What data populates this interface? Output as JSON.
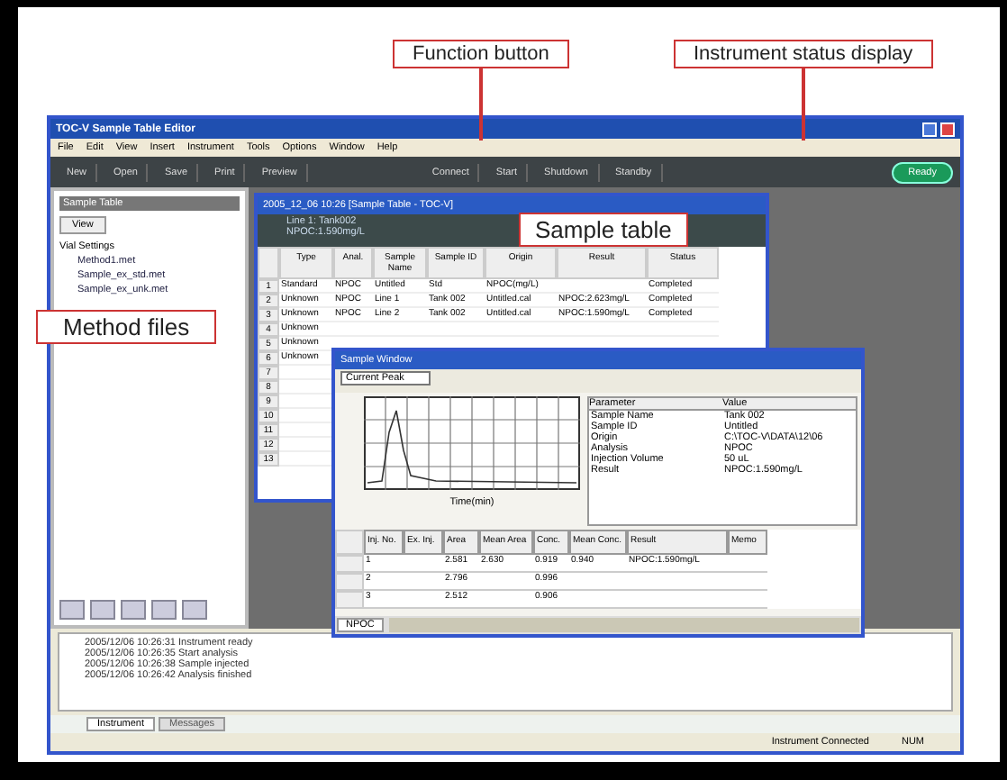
{
  "annotations": [
    {
      "text": "Function button"
    },
    {
      "text": "Instrument status display"
    },
    {
      "text": "Sample table"
    },
    {
      "text": "Method files"
    }
  ],
  "window": {
    "title": "TOC-V Sample Table Editor"
  },
  "menu": [
    "File",
    "Edit",
    "View",
    "Insert",
    "Instrument",
    "Tools",
    "Options",
    "Window",
    "Help"
  ],
  "toolbar": [
    {
      "label": "New"
    },
    {
      "label": "Open"
    },
    {
      "label": "Save"
    },
    {
      "label": "Print"
    },
    {
      "label": "Preview"
    },
    {
      "label": "Connect"
    },
    {
      "label": "Start"
    },
    {
      "label": "Shutdown"
    },
    {
      "label": "Standby"
    }
  ],
  "status_button": {
    "label": "Ready"
  },
  "method_panel": {
    "title": "Sample Table",
    "view_button": "View",
    "tree": [
      {
        "label": "Vial Settings",
        "children": [
          {
            "label": "Method1.met"
          },
          {
            "label": "Sample_ex_std.met"
          },
          {
            "label": "Sample_ex_unk.met"
          }
        ]
      }
    ]
  },
  "sample_table": {
    "title": "2005_12_06 10:26 [Sample Table - TOC-V]",
    "info": [
      "Line 1: Tank002",
      "NPOC:1.590mg/L"
    ],
    "columns": [
      "Type",
      "Anal.",
      "Sample Name",
      "Sample ID",
      "Origin",
      "Result",
      "Status"
    ],
    "rows": [
      [
        "Standard",
        "NPOC",
        "Untitled",
        "Std",
        "NPOC(mg/L)",
        "",
        "Completed"
      ],
      [
        "Unknown",
        "NPOC",
        "Line 1",
        "Tank 002",
        "Untitled.cal",
        "NPOC:2.623mg/L",
        "Completed"
      ],
      [
        "Unknown",
        "NPOC",
        "Line 2",
        "Tank 002",
        "Untitled.cal",
        "NPOC:1.590mg/L",
        "Completed"
      ],
      [
        "Unknown",
        "",
        "",
        "",
        "",
        "",
        ""
      ],
      [
        "Unknown",
        "",
        "",
        "",
        "",
        "",
        ""
      ],
      [
        "Unknown",
        "",
        "",
        "",
        "",
        "",
        ""
      ]
    ],
    "row_numbers": [
      "1",
      "2",
      "3",
      "4",
      "5",
      "6",
      "7",
      "8",
      "9",
      "10",
      "11",
      "12",
      "13"
    ]
  },
  "sample_window": {
    "title": "Sample Window",
    "dropdown": "Current Peak",
    "x_label": "Time(min)",
    "params_columns": [
      "Parameter",
      "Value"
    ],
    "params": [
      [
        "Sample Name",
        "Tank 002"
      ],
      [
        "Sample ID",
        "Untitled"
      ],
      [
        "Origin",
        "C:\\TOC-V\\DATA\\12\\06"
      ],
      [
        "Analysis",
        "NPOC"
      ],
      [
        "Injection Volume",
        "50 uL"
      ],
      [
        "Result",
        "NPOC:1.590mg/L"
      ]
    ],
    "columns": [
      "Inj. No.",
      "Ex. Inj.",
      "Area",
      "Mean Area",
      "Conc.",
      "Mean Conc.",
      "Result",
      "Memo"
    ],
    "rows": [
      [
        "1",
        "",
        "2.581",
        "2.630",
        "0.919",
        "0.940",
        "NPOC:1.590mg/L",
        ""
      ],
      [
        "2",
        "",
        "2.796",
        "",
        "0.996",
        "",
        "",
        ""
      ],
      [
        "3",
        "",
        "2.512",
        "",
        "0.906",
        "",
        "",
        ""
      ]
    ],
    "sheet_tab": "NPOC"
  },
  "log": [
    "2005/12/06 10:26:31  Instrument ready",
    "2005/12/06 10:26:35  Start analysis",
    "2005/12/06 10:26:38  Sample injected",
    "2005/12/06 10:26:42  Analysis finished"
  ],
  "log_tabs": [
    {
      "label": "Instrument",
      "selected": true
    },
    {
      "label": "Messages",
      "selected": false
    }
  ],
  "status_bar": [
    "Instrument Connected",
    "NUM"
  ]
}
